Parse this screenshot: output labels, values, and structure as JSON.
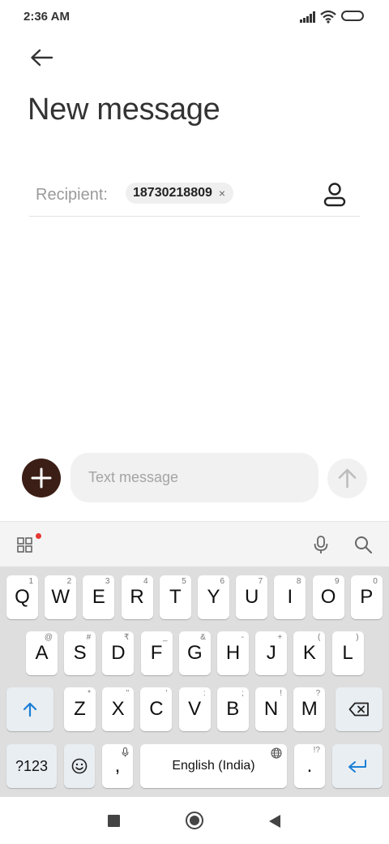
{
  "status_bar": {
    "time": "2:36 AM"
  },
  "header": {
    "title": "New message"
  },
  "recipient": {
    "label": "Recipient:",
    "chip": "18730218809",
    "chip_remove": "×"
  },
  "compose": {
    "placeholder": "Text message"
  },
  "keyboard": {
    "row1": [
      {
        "key": "Q",
        "hint": "1"
      },
      {
        "key": "W",
        "hint": "2"
      },
      {
        "key": "E",
        "hint": "3"
      },
      {
        "key": "R",
        "hint": "4"
      },
      {
        "key": "T",
        "hint": "5"
      },
      {
        "key": "Y",
        "hint": "6"
      },
      {
        "key": "U",
        "hint": "7"
      },
      {
        "key": "I",
        "hint": "8"
      },
      {
        "key": "O",
        "hint": "9"
      },
      {
        "key": "P",
        "hint": "0"
      }
    ],
    "row2": [
      {
        "key": "A",
        "hint": "@"
      },
      {
        "key": "S",
        "hint": "#"
      },
      {
        "key": "D",
        "hint": "₹"
      },
      {
        "key": "F",
        "hint": "_"
      },
      {
        "key": "G",
        "hint": "&"
      },
      {
        "key": "H",
        "hint": "-"
      },
      {
        "key": "J",
        "hint": "+"
      },
      {
        "key": "K",
        "hint": "("
      },
      {
        "key": "L",
        "hint": ")"
      }
    ],
    "row3": [
      {
        "key": "Z",
        "hint": "*"
      },
      {
        "key": "X",
        "hint": "\""
      },
      {
        "key": "C",
        "hint": "'"
      },
      {
        "key": "V",
        "hint": ":"
      },
      {
        "key": "B",
        "hint": ";"
      },
      {
        "key": "N",
        "hint": "!"
      },
      {
        "key": "M",
        "hint": "?"
      }
    ],
    "symbols_label": "?123",
    "comma": ",",
    "space_label": "English (India)",
    "period": ".",
    "period_hint": "!?"
  },
  "colors": {
    "attach_button": "#3b1f17",
    "accent_blue": "#1a7fd6",
    "notification_dot": "#e53935"
  }
}
